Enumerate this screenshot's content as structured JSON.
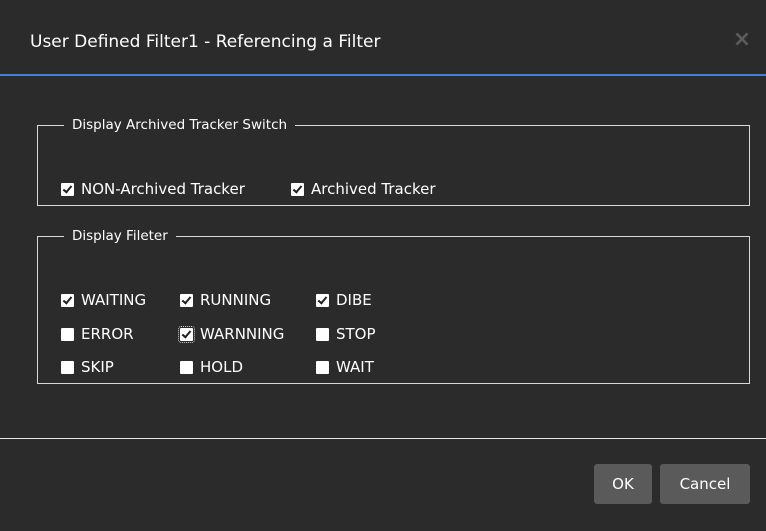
{
  "dialog": {
    "title": "User Defined Filter1 - Referencing a Filter",
    "close_symbol": "×"
  },
  "archive_group": {
    "legend": "Display Archived Tracker Switch",
    "options": [
      {
        "label": "NON-Archived Tracker",
        "checked": true
      },
      {
        "label": "Archived Tracker",
        "checked": true
      }
    ]
  },
  "filter_group": {
    "legend": "Display Fileter",
    "options": [
      {
        "label": "WAITING",
        "checked": true
      },
      {
        "label": "RUNNING",
        "checked": true
      },
      {
        "label": "DIBE",
        "checked": true
      },
      {
        "label": "ERROR",
        "checked": false
      },
      {
        "label": "WARNNING",
        "checked": true,
        "focused": true
      },
      {
        "label": "STOP",
        "checked": false
      },
      {
        "label": "SKIP",
        "checked": false
      },
      {
        "label": "HOLD",
        "checked": false
      },
      {
        "label": "WAIT",
        "checked": false
      }
    ]
  },
  "buttons": {
    "ok_label": "OK",
    "cancel_label": "Cancel"
  },
  "colors": {
    "background": "#2b2b2b",
    "header_accent": "#3f7fd6",
    "button_bg": "#5a5a5a"
  }
}
